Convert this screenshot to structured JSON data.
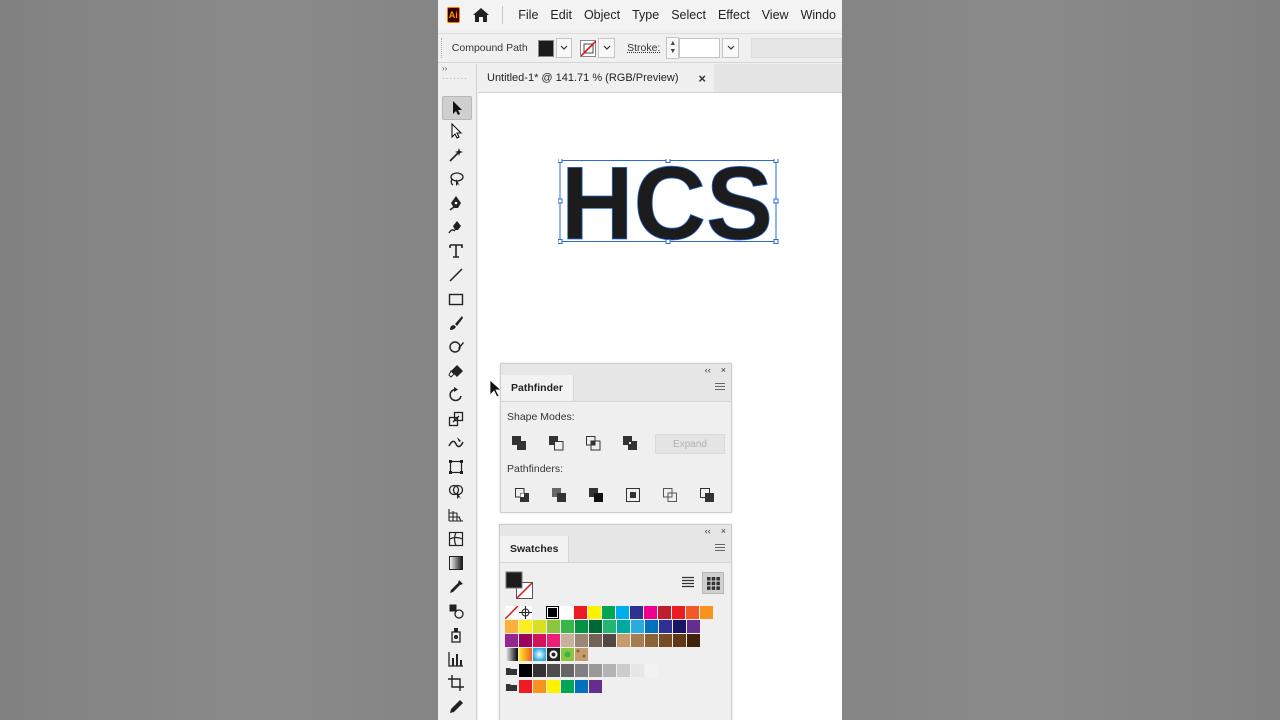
{
  "app": {
    "logo_text": "Ai",
    "menu": [
      "File",
      "Edit",
      "Object",
      "Type",
      "Select",
      "Effect",
      "View",
      "Windo"
    ]
  },
  "control_bar": {
    "selection_type": "Compound Path",
    "stroke_label": "Stroke:",
    "stroke_value": ""
  },
  "document": {
    "tab_title": "Untitled-1* @ 141.71 % (RGB/Preview)",
    "close_glyph": "×",
    "artwork_text": "HCS"
  },
  "pathfinder": {
    "tab": "Pathfinder",
    "shape_modes_label": "Shape Modes:",
    "expand_label": "Expand",
    "pathfinders_label": "Pathfinders:",
    "collapse_glyph": "‹‹",
    "close_glyph": "×"
  },
  "swatches": {
    "tab": "Swatches",
    "collapse_glyph": "‹‹",
    "close_glyph": "×",
    "rows": [
      [
        "#ffffff",
        "#ed1c24",
        "#fff200",
        "#00a651",
        "#00aeef",
        "#2e3192",
        "#ec008c",
        "#be1e2d",
        "#ed1c24",
        "#f15a24",
        "#f7931e"
      ],
      [
        "#fbb03b",
        "#fcee21",
        "#d9e021",
        "#8cc63f",
        "#39b54a",
        "#009245",
        "#006837",
        "#22b573",
        "#00a99d",
        "#29abe2",
        "#0071bc",
        "#2e3192",
        "#1b1464",
        "#662d91"
      ],
      [
        "#93278f",
        "#9e005d",
        "#d4145a",
        "#ed1e79",
        "#c7b299",
        "#998675",
        "#736357",
        "#534741",
        "#c69c6d",
        "#a67c52",
        "#8c6239",
        "#754c24",
        "#603813",
        "#42210b"
      ],
      [
        "#000000",
        "#333333",
        "#4d4d4d",
        "#666666",
        "#808080",
        "#999999",
        "#b3b3b3",
        "#cccccc",
        "#e6e6e6",
        "#f2f2f2"
      ],
      [
        "#ed1c24",
        "#f7931e",
        "#fff200",
        "#00a651",
        "#0071bc",
        "#662d91"
      ]
    ],
    "accent": "#1c1c1c"
  },
  "colors": {
    "selection": "#2a6ad8",
    "artwork_fill": "#1c1c1c"
  }
}
